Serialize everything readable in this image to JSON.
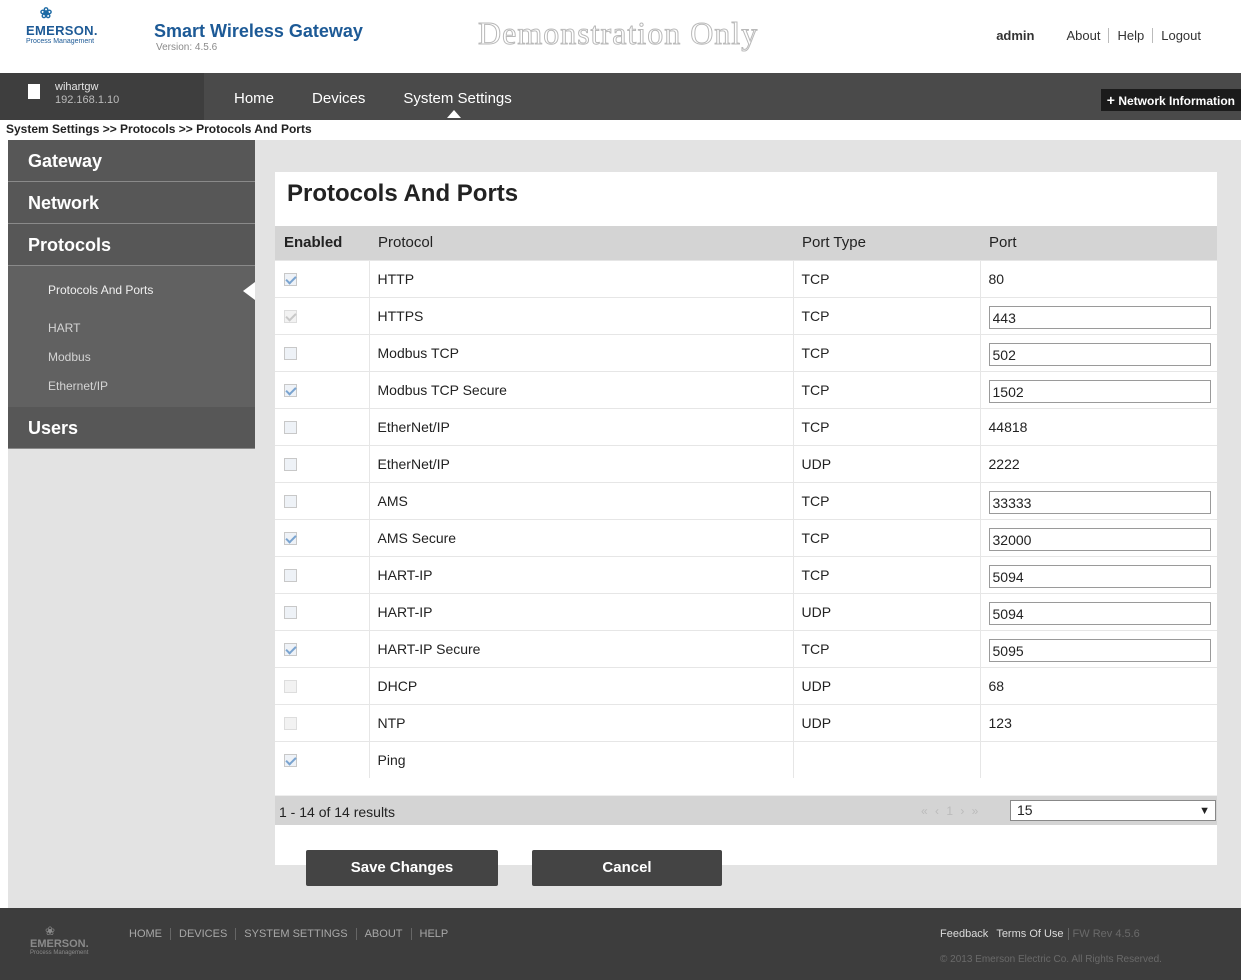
{
  "header": {
    "logo_name": "EMERSON.",
    "logo_sub": "Process Management",
    "app_title": "Smart Wireless Gateway",
    "version": "Version: 4.5.6",
    "demo_banner": "Demonstration Only",
    "user": "admin",
    "links": [
      "About",
      "Help",
      "Logout"
    ]
  },
  "nav": {
    "host_name": "wihartgw",
    "host_ip": "192.168.1.10",
    "items": [
      "Home",
      "Devices",
      "System Settings"
    ],
    "active_item": "System Settings",
    "network_info": "Network Information"
  },
  "breadcrumb": "System Settings >> Protocols >> Protocols And Ports",
  "sidebar": {
    "gateway": "Gateway",
    "network": "Network",
    "protocols": "Protocols",
    "protocol_items": [
      "Protocols And Ports",
      "HART",
      "Modbus",
      "Ethernet/IP"
    ],
    "active_item": "Protocols And Ports",
    "users": "Users"
  },
  "main": {
    "title": "Protocols And Ports",
    "columns": [
      "Enabled",
      "Protocol",
      "Port Type",
      "Port"
    ],
    "rows": [
      {
        "enabled": true,
        "disabled": false,
        "protocol": "HTTP",
        "port_type": "TCP",
        "port": "80",
        "editable": false
      },
      {
        "enabled": true,
        "disabled": true,
        "protocol": "HTTPS",
        "port_type": "TCP",
        "port": "443",
        "editable": true
      },
      {
        "enabled": false,
        "disabled": false,
        "protocol": "Modbus TCP",
        "port_type": "TCP",
        "port": "502",
        "editable": true
      },
      {
        "enabled": true,
        "disabled": false,
        "protocol": "Modbus TCP Secure",
        "port_type": "TCP",
        "port": "1502",
        "editable": true
      },
      {
        "enabled": false,
        "disabled": false,
        "protocol": "EtherNet/IP",
        "port_type": "TCP",
        "port": "44818",
        "editable": false
      },
      {
        "enabled": false,
        "disabled": false,
        "protocol": "EtherNet/IP",
        "port_type": "UDP",
        "port": "2222",
        "editable": false
      },
      {
        "enabled": false,
        "disabled": false,
        "protocol": "AMS",
        "port_type": "TCP",
        "port": "33333",
        "editable": true
      },
      {
        "enabled": true,
        "disabled": false,
        "protocol": "AMS Secure",
        "port_type": "TCP",
        "port": "32000",
        "editable": true
      },
      {
        "enabled": false,
        "disabled": false,
        "protocol": "HART-IP",
        "port_type": "TCP",
        "port": "5094",
        "editable": true
      },
      {
        "enabled": false,
        "disabled": false,
        "protocol": "HART-IP",
        "port_type": "UDP",
        "port": "5094",
        "editable": true
      },
      {
        "enabled": true,
        "disabled": false,
        "protocol": "HART-IP Secure",
        "port_type": "TCP",
        "port": "5095",
        "editable": true
      },
      {
        "enabled": false,
        "disabled": true,
        "protocol": "DHCP",
        "port_type": "UDP",
        "port": "68",
        "editable": false
      },
      {
        "enabled": false,
        "disabled": true,
        "protocol": "NTP",
        "port_type": "UDP",
        "port": "123",
        "editable": false
      },
      {
        "enabled": true,
        "disabled": false,
        "protocol": "Ping",
        "port_type": "",
        "port": "",
        "editable": false
      }
    ],
    "results_text": "1 - 14 of 14 results",
    "pager_arrows": "« ‹ 1 › »",
    "page_size": "15",
    "save_label": "Save Changes",
    "cancel_label": "Cancel"
  },
  "footer": {
    "logo_name": "EMERSON.",
    "logo_sub": "Process Management",
    "links": [
      "HOME",
      "DEVICES",
      "SYSTEM SETTINGS",
      "ABOUT",
      "HELP"
    ],
    "feedback": "Feedback",
    "terms": "Terms Of Use",
    "fw_rev": "FW Rev 4.5.6",
    "copyright": "© 2013 Emerson Electric Co. All Rights Reserved."
  },
  "colors": {
    "brand_blue": "#1d5a96",
    "nav_bg": "#4a4a4a",
    "sidebar_bg": "#575757",
    "button_bg": "#444444",
    "footer_bg": "#3d3d3d"
  },
  "icons": [
    "emerson-logo-icon",
    "gateway-document-icon",
    "plus-icon",
    "active-caret-icon",
    "checkbox-icon",
    "dropdown-arrow-icon"
  ]
}
